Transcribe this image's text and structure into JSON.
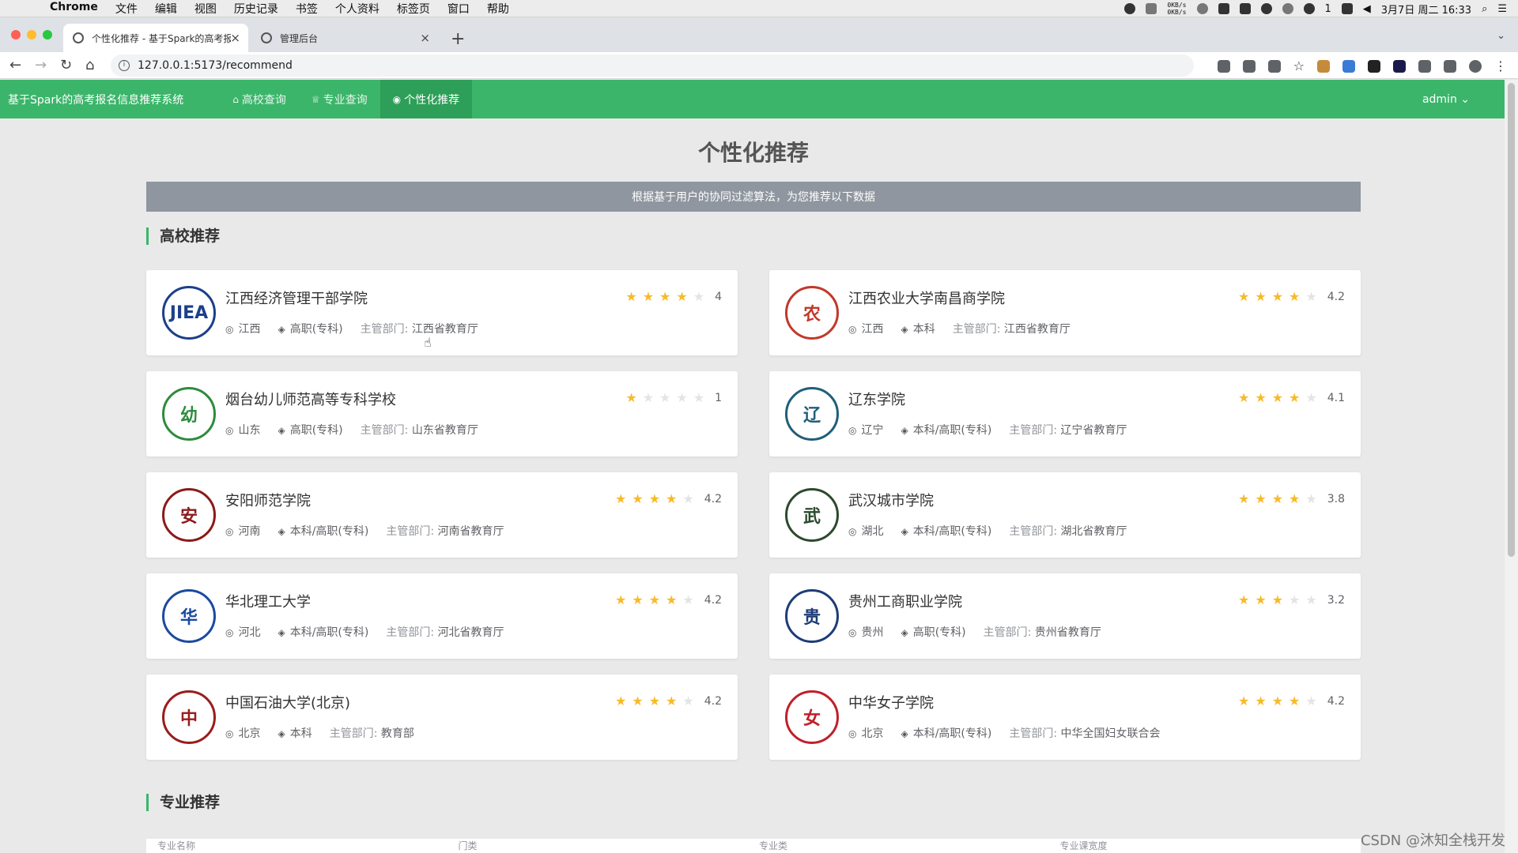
{
  "macos": {
    "menus": [
      "Chrome",
      "文件",
      "编辑",
      "视图",
      "历史记录",
      "书签",
      "个人资料",
      "标签页",
      "窗口",
      "帮助"
    ],
    "net_up": "0KB/s",
    "net_down": "0KB/s",
    "wechat_count": "1",
    "clock": "3月7日 周二 16:33"
  },
  "browser": {
    "tabs": [
      {
        "title": "个性化推荐 - 基于Spark的高考报"
      },
      {
        "title": "管理后台"
      }
    ],
    "url": "127.0.0.1:5173/recommend"
  },
  "app": {
    "brand": "基于Spark的高考报名信息推荐系统",
    "nav": [
      "高校查询",
      "专业查询",
      "个性化推荐"
    ],
    "user": "admin ⌄",
    "page_title": "个性化推荐",
    "banner": "根据基于用户的协同过滤算法，为您推荐以下数据",
    "section_school": "高校推荐",
    "section_major": "专业推荐",
    "dept_label": "主管部门:",
    "table_headers": [
      "专业名称",
      "门类",
      "专业类",
      "专业课宽度"
    ]
  },
  "schools": [
    {
      "name": "江西经济管理干部学院",
      "province": "江西",
      "level": "高职(专科)",
      "dept": "江西省教育厅",
      "score": "4",
      "stars": 4,
      "logo": "JIEA",
      "color": "#1d3f8a"
    },
    {
      "name": "江西农业大学南昌商学院",
      "province": "江西",
      "level": "本科",
      "dept": "江西省教育厅",
      "score": "4.2",
      "stars": 4,
      "logo": "农",
      "color": "#c0392b"
    },
    {
      "name": "烟台幼儿师范高等专科学校",
      "province": "山东",
      "level": "高职(专科)",
      "dept": "山东省教育厅",
      "score": "1",
      "stars": 1,
      "logo": "幼",
      "color": "#2e8b3d"
    },
    {
      "name": "辽东学院",
      "province": "辽宁",
      "level": "本科/高职(专科)",
      "dept": "辽宁省教育厅",
      "score": "4.1",
      "stars": 4,
      "logo": "辽",
      "color": "#1f5f7a"
    },
    {
      "name": "安阳师范学院",
      "province": "河南",
      "level": "本科/高职(专科)",
      "dept": "河南省教育厅",
      "score": "4.2",
      "stars": 4,
      "logo": "安",
      "color": "#8b1a1a"
    },
    {
      "name": "武汉城市学院",
      "province": "湖北",
      "level": "本科/高职(专科)",
      "dept": "湖北省教育厅",
      "score": "3.8",
      "stars": 4,
      "logo": "武",
      "color": "#2c4a2c"
    },
    {
      "name": "华北理工大学",
      "province": "河北",
      "level": "本科/高职(专科)",
      "dept": "河北省教育厅",
      "score": "4.2",
      "stars": 4,
      "logo": "华",
      "color": "#1b4aa0"
    },
    {
      "name": "贵州工商职业学院",
      "province": "贵州",
      "level": "高职(专科)",
      "dept": "贵州省教育厅",
      "score": "3.2",
      "stars": 3,
      "logo": "贵",
      "color": "#1e3c78"
    },
    {
      "name": "中国石油大学(北京)",
      "province": "北京",
      "level": "本科",
      "dept": "教育部",
      "score": "4.2",
      "stars": 4,
      "logo": "中",
      "color": "#9b1c1c"
    },
    {
      "name": "中华女子学院",
      "province": "北京",
      "level": "本科/高职(专科)",
      "dept": "中华全国妇女联合会",
      "score": "4.2",
      "stars": 4,
      "logo": "女",
      "color": "#c0202a"
    }
  ],
  "credit": "CSDN @沐知全栈开发",
  "colors": {
    "nav_green": "#3bb56a",
    "star": "#f7ba2a",
    "banner": "#8f969f"
  }
}
